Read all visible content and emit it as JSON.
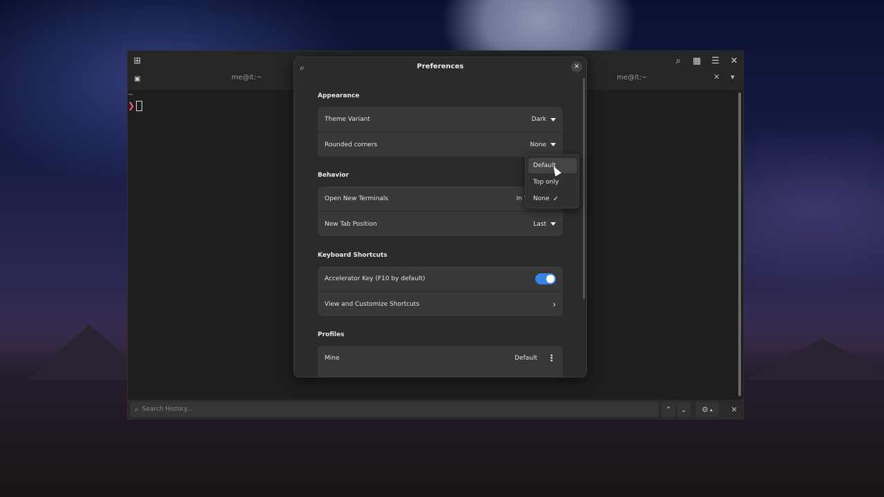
{
  "terminal": {
    "tabs": [
      {
        "title": "me@it:~"
      },
      {
        "title": "me@it:~"
      }
    ],
    "prompt_symbol": "~",
    "prompt_arrow": "❯",
    "search_placeholder": "Search History..."
  },
  "preferences": {
    "title": "Preferences",
    "sections": {
      "appearance": {
        "title": "Appearance",
        "theme_variant": {
          "label": "Theme Variant",
          "value": "Dark"
        },
        "rounded_corners": {
          "label": "Rounded corners",
          "value": "None"
        }
      },
      "behavior": {
        "title": "Behavior",
        "open_new_terminals": {
          "label": "Open New Terminals",
          "value": "In V"
        },
        "new_tab_position": {
          "label": "New Tab Position",
          "value": "Last"
        }
      },
      "keyboard": {
        "title": "Keyboard Shortcuts",
        "accelerator": {
          "label": "Accelerator Key (F10 by default)",
          "enabled": true
        },
        "view_shortcuts": {
          "label": "View and Customize Shortcuts"
        }
      },
      "profiles": {
        "title": "Profiles",
        "mine": {
          "label": "Mine",
          "value": "Default"
        }
      }
    }
  },
  "rounded_corners_popover": {
    "options": [
      "Default",
      "Top only",
      "None"
    ],
    "selected": "None",
    "hovered": "Default"
  },
  "colors": {
    "accent": "#3584e4",
    "prompt_arrow": "#ff5d7a"
  }
}
